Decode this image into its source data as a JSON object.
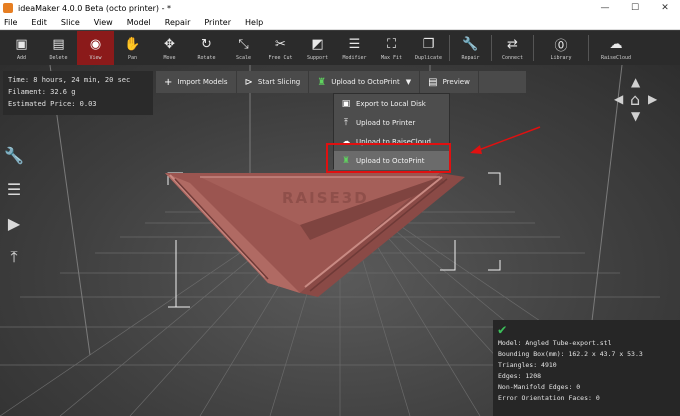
{
  "window": {
    "title": "ideaMaker 4.0.0 Beta (octo printer) - *",
    "minimize": "—",
    "maximize": "☐",
    "close": "✕"
  },
  "menu": [
    "File",
    "Edit",
    "Slice",
    "View",
    "Model",
    "Repair",
    "Printer",
    "Help"
  ],
  "toolbar": [
    {
      "label": "Add",
      "icon": "add-icon",
      "glyph": "▣"
    },
    {
      "label": "Delete",
      "icon": "delete-icon",
      "glyph": "▤"
    },
    {
      "label": "View",
      "icon": "eye-icon",
      "glyph": "◉"
    },
    {
      "label": "Pan",
      "icon": "hand-icon",
      "glyph": "✋"
    },
    {
      "label": "Move",
      "icon": "move-icon",
      "glyph": "✥"
    },
    {
      "label": "Rotate",
      "icon": "rotate-icon",
      "glyph": "↻"
    },
    {
      "label": "Scale",
      "icon": "scale-icon",
      "glyph": "⤡"
    },
    {
      "label": "Free Cut",
      "icon": "cut-icon",
      "glyph": "✂"
    },
    {
      "label": "Support",
      "icon": "support-icon",
      "glyph": "◩"
    },
    {
      "label": "Modifier",
      "icon": "modifier-icon",
      "glyph": "☰"
    },
    {
      "label": "Max Fit",
      "icon": "max-fit-icon",
      "glyph": "⛶"
    },
    {
      "label": "Duplicate",
      "icon": "duplicate-icon",
      "glyph": "❐"
    },
    {
      "label": "Repair",
      "icon": "wrench-icon",
      "glyph": "🔧"
    },
    {
      "label": "Connect",
      "icon": "connect-icon",
      "glyph": "⇄"
    },
    {
      "label": "Library",
      "icon": "library-icon",
      "glyph": "⓪"
    },
    {
      "label": "RaiseCloud",
      "icon": "cloud-icon",
      "glyph": "☁"
    }
  ],
  "print_info": {
    "time": "Time: 8 hours, 24 min, 20 sec",
    "filament": "Filament: 32.6 g",
    "price": "Estimated Price: 0.03"
  },
  "actions": {
    "import": "Import Models",
    "slicing": "Start Slicing",
    "upload": "Upload to OctoPrint",
    "preview": "Preview"
  },
  "dropdown": [
    {
      "label": "Export to Local Disk",
      "icon": "disk-icon",
      "glyph": "▣"
    },
    {
      "label": "Upload to Printer",
      "icon": "upload-icon",
      "glyph": "⤒"
    },
    {
      "label": "Upload to RaiseCloud",
      "icon": "cloud-icon",
      "glyph": "☁"
    },
    {
      "label": "Upload to OctoPrint",
      "icon": "octoprint-icon",
      "glyph": "♜"
    }
  ],
  "side_icons": [
    {
      "icon": "wrench-icon",
      "glyph": "🔧"
    },
    {
      "icon": "list-icon",
      "glyph": "☰"
    },
    {
      "icon": "play-icon",
      "glyph": "▶"
    },
    {
      "icon": "export-icon",
      "glyph": "⤒"
    }
  ],
  "model_text": "RAISE3D",
  "model_info": {
    "check": "✔",
    "model": "Model: Angled Tube-export.stl",
    "bbox": "Bounding Box(mm): 162.2 x 43.7 x 53.3",
    "triangles": "Triangles: 4910",
    "edges": "Edges: 1208",
    "non_manifold": "Non-Manifold Edges: 0",
    "error_faces": "Error Orientation Faces: 0"
  },
  "colors": {
    "model": "#a8625c",
    "active_tool": "#8b1a1a",
    "highlight": "#e01010",
    "octoprint_green": "#5fd35f"
  }
}
